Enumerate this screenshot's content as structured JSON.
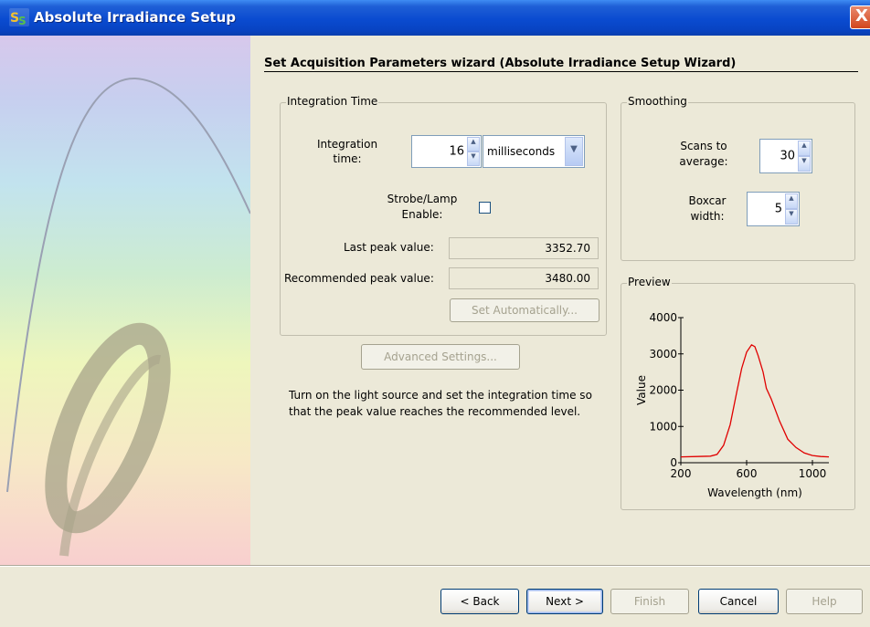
{
  "window": {
    "title": "Absolute Irradiance Setup",
    "close_glyph": "X",
    "icons": {
      "app": "app-logo-icon",
      "close": "close-icon"
    }
  },
  "wizard": {
    "title": "Set Acquisition Parameters wizard (Absolute Irradiance Setup Wizard)",
    "integration_group": {
      "legend": "Integration Time",
      "integration_label_line1": "Integration",
      "integration_label_line2": "time:",
      "integration_value": "16",
      "unit_value": "milliseconds",
      "strobe_label_line1": "Strobe/Lamp",
      "strobe_label_line2": "Enable:",
      "strobe_checked": false,
      "last_peak_label": "Last peak value:",
      "last_peak_value": "3352.70",
      "recommended_peak_label": "Recommended peak value:",
      "recommended_peak_value": "3480.00",
      "set_automatically_label": "Set Automatically..."
    },
    "advanced_settings_label": "Advanced Settings...",
    "help_text": "Turn on the light source and set the integration time so that the peak value reaches the recommended level.",
    "smoothing_group": {
      "legend": "Smoothing",
      "scans_label_line1": "Scans to",
      "scans_label_line2": "average:",
      "scans_value": "30",
      "boxcar_label_line1": "Boxcar",
      "boxcar_label_line2": "width:",
      "boxcar_value": "5"
    },
    "preview_group": {
      "legend": "Preview"
    }
  },
  "buttons": {
    "back": "< Back",
    "next": "Next >",
    "finish": "Finish",
    "cancel": "Cancel",
    "help": "Help"
  },
  "colors": {
    "series": "#e00000",
    "title_bar": "#0a4bd0"
  },
  "chart_data": {
    "type": "line",
    "title": "",
    "xlabel": "Wavelength (nm)",
    "ylabel": "Value",
    "xlim": [
      200,
      1100
    ],
    "ylim": [
      0,
      4000
    ],
    "x_ticks": [
      200,
      600,
      1000
    ],
    "y_ticks": [
      0,
      1000,
      2000,
      3000,
      4000
    ],
    "grid": false,
    "series": [
      {
        "name": "",
        "x": [
          200,
          300,
          380,
          420,
          460,
          500,
          540,
          570,
          600,
          630,
          650,
          670,
          700,
          720,
          750,
          800,
          850,
          900,
          950,
          1000,
          1050,
          1100
        ],
        "y": [
          160,
          170,
          180,
          230,
          480,
          1050,
          1950,
          2600,
          3050,
          3250,
          3200,
          2950,
          2500,
          2050,
          1750,
          1150,
          650,
          420,
          270,
          200,
          170,
          160
        ]
      }
    ]
  }
}
